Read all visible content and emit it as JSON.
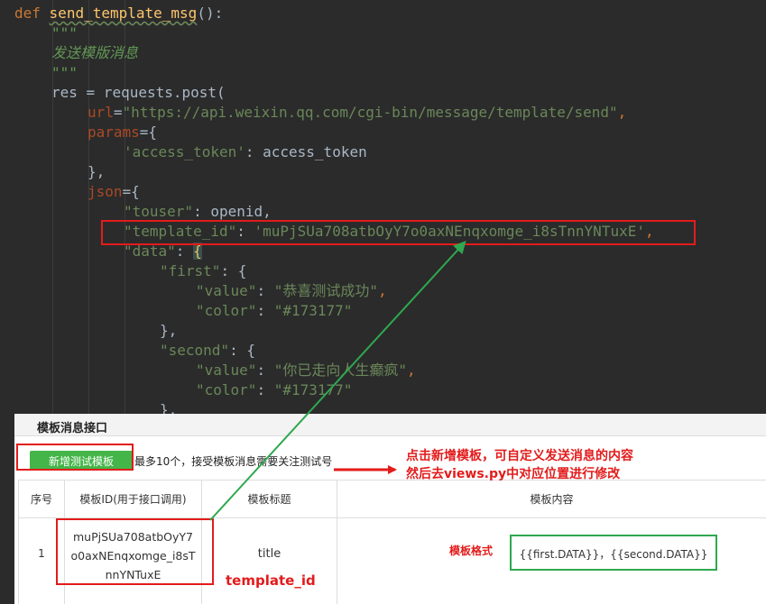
{
  "code": {
    "l1_def": "def",
    "l1_fn": "send_template_msg",
    "l1_rest": "():",
    "l2_doc": "\"\"\"",
    "l3_doc": "发送模版消息",
    "l4_doc": "\"\"\"",
    "l5_var": "res",
    "l5_rest": " = requests.post(",
    "l6_param": "url",
    "l6_eq": "=",
    "l6_str": "\"https://api.weixin.qq.com/cgi-bin/message/template/send\"",
    "l6_comma": ",",
    "l7_param": "params",
    "l7_rest": "={",
    "l8_str": "'access_token'",
    "l8_rest": ": access_token",
    "l9_text": "},",
    "l10_param": "json",
    "l10_rest": "={",
    "l11_str": "\"touser\"",
    "l11_rest": ": openid,",
    "l12_key": "\"template_id\"",
    "l12_colon": ": ",
    "l12_val": "'muPjSUa708atbOyY7o0axNEnqxomge_i8sTnnYNTuxE'",
    "l12_comma": ",",
    "l13_key": "\"data\"",
    "l13_colon": ": ",
    "l13_brace": "{",
    "l14_key": "\"first\"",
    "l14_rest": ": {",
    "l15_key": "\"value\"",
    "l15_colon": ": ",
    "l15_val": "\"恭喜测试成功\"",
    "l15_comma": ",",
    "l16_key": "\"color\"",
    "l16_colon": ": ",
    "l16_val": "\"#173177\"",
    "l17_text": "},",
    "l18_key": "\"second\"",
    "l18_rest": ": {",
    "l19_key": "\"value\"",
    "l19_colon": ": ",
    "l19_val": "\"你已走向人生癫疯\"",
    "l19_comma": ",",
    "l20_key": "\"color\"",
    "l20_colon": ": ",
    "l20_val": "\"#173177\"",
    "l21_text": "},"
  },
  "panel": {
    "title": "模板消息接口",
    "add_button": "新增测试模板",
    "note": "最多10个，接受模板消息需要关注测试号",
    "headers": [
      "序号",
      "模板ID(用于接口调用)",
      "模板标题",
      "模板内容"
    ],
    "row": {
      "index": "1",
      "template_id_lines": [
        "muPjSUa708atbOyY7",
        "o0axNEnqxomge_i8sT",
        "nnYNTuxE"
      ],
      "title": "title",
      "content": "{{first.DATA}}，{{second.DATA}}"
    }
  },
  "annotations": {
    "instruction_line1": "点击新增模板，可自定义发送消息的内容",
    "instruction_line2": "然后去views.py中对应位置进行修改",
    "template_id_label": "template_id",
    "format_label": "模板格式"
  },
  "colors": {
    "editor_bg": "#2b2b2b",
    "red": "#e31b1b",
    "green_arrow": "#2fa84f",
    "button_green": "#44b549"
  }
}
